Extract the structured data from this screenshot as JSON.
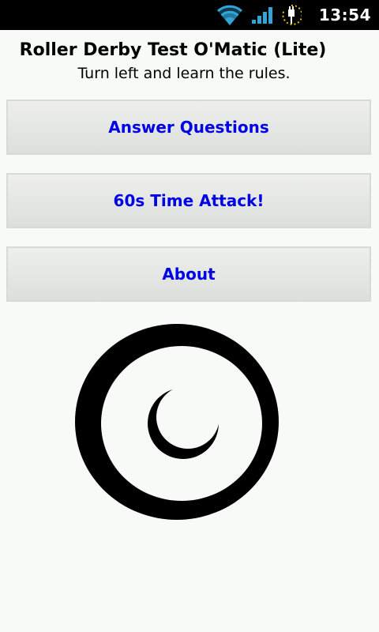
{
  "status_bar": {
    "time": "13:54",
    "icons": [
      "wifi-icon",
      "signal-icon",
      "battery-charging-icon"
    ]
  },
  "header": {
    "title": "Roller Derby Test O'Matic (Lite)",
    "subtitle": "Turn left and learn the rules."
  },
  "menu": {
    "buttons": [
      {
        "label": "Answer Questions"
      },
      {
        "label": "60s Time Attack!"
      },
      {
        "label": "About"
      }
    ]
  },
  "logo": {
    "icon": "spiral-logo-icon"
  },
  "colors": {
    "button_text": "#0000e6",
    "background": "#f7faf7",
    "status_bar": "#000000"
  }
}
